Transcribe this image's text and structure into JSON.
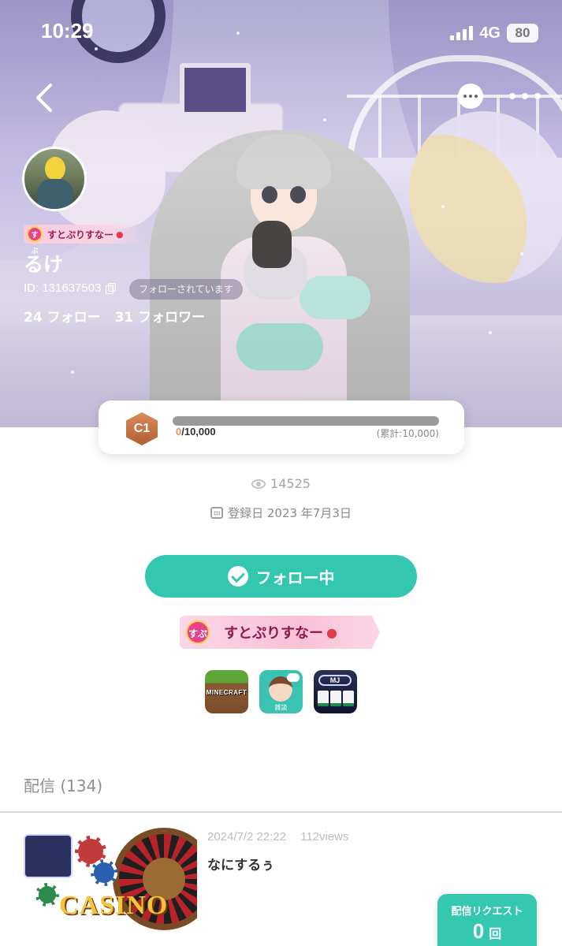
{
  "status_bar": {
    "time": "10:29",
    "network": "4G",
    "battery": "80"
  },
  "profile": {
    "badge_text": "すとぷりすなー",
    "username": "るけ",
    "id_text": "ID: 131637503",
    "followed_chip": "フォローされています",
    "following": "24 フォロー",
    "followers": "31 フォロワー"
  },
  "level": {
    "rank": "C1",
    "current": "0",
    "target": "/10,000",
    "total": "(累計:10,000)",
    "progress_fraction": 0
  },
  "stats": {
    "views": "14525",
    "registered": "登録日 2023 年7月3日"
  },
  "follow_button": {
    "label": "フォロー中"
  },
  "big_badge": {
    "text": "すとぷりすなー"
  },
  "genres": [
    {
      "icon": "minecraft-icon",
      "label": "MINECRAFT"
    },
    {
      "icon": "chat-genre-icon",
      "label": "雑談"
    },
    {
      "icon": "mahjong-icon",
      "label": "MJ"
    }
  ],
  "streams": {
    "section_title": "配信 (134)",
    "items": [
      {
        "date": "2024/7/2 22:22",
        "views": "112views",
        "title": "なにするぅ",
        "thumb_text": "CASINO"
      }
    ]
  },
  "request": {
    "label": "配信リクエスト",
    "count": "0",
    "unit": "回"
  },
  "colors": {
    "accent": "#33c7b0",
    "badge_pink": "#f9c1d8",
    "level_orange": "#e8924f"
  }
}
